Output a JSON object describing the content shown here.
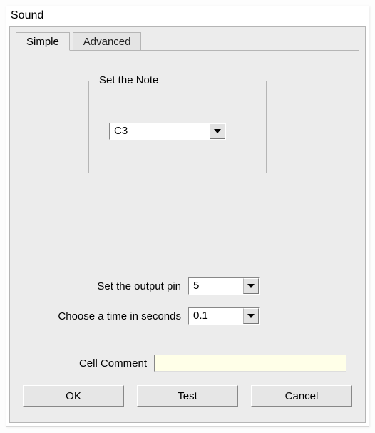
{
  "window": {
    "title": "Sound"
  },
  "tabs": {
    "simple": "Simple",
    "advanced": "Advanced",
    "active": "Simple"
  },
  "group": {
    "legend": "Set the Note"
  },
  "note": {
    "selected": "C3"
  },
  "output_pin": {
    "label": "Set the output pin",
    "selected": "5"
  },
  "time_seconds": {
    "label": "Choose a time in seconds",
    "selected": "0.1"
  },
  "cell_comment": {
    "label": "Cell Comment",
    "value": ""
  },
  "buttons": {
    "ok": "OK",
    "test": "Test",
    "cancel": "Cancel"
  }
}
